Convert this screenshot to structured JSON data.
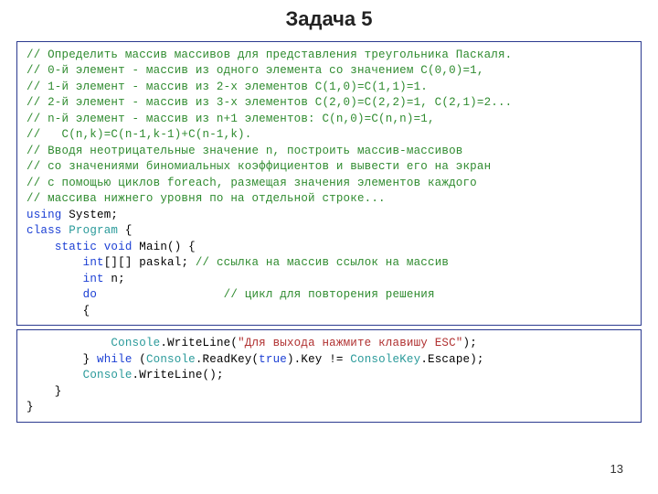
{
  "title": "Задача 5",
  "page_number": "13",
  "code1": {
    "c01": "// Определить массив массивов для представления треугольника Паскаля.",
    "c02": "// 0-й элемент - массив из одного элемента со значением С(0,0)=1,",
    "c03": "// 1-й элемент - массив из 2-х элементов С(1,0)=С(1,1)=1.",
    "c04": "// 2-й элемент - массив из 3-х элементов С(2,0)=С(2,2)=1, С(2,1)=2...",
    "c05": "// n-й элемент - массив из n+1 элементов: С(n,0)=С(n,n)=1,",
    "c06": "//   С(n,k)=C(n-1,k-1)+C(n-1,k).",
    "c07": "// Вводя неотрицательные значение n, построить массив-массивов",
    "c08": "// со значениями биномиальных коэффициентов и вывести его на экран",
    "c09": "// с помощью циклов foreach, размещая значения элементов каждого",
    "c10": "// массива нижнего уровня по на отдельной строке...",
    "k_using": "using",
    "t_system": " System;",
    "k_class": "class",
    "t_program": "Program",
    "t_openbrace": " {",
    "k_static": "static",
    "k_void": "void",
    "t_main": " Main() {",
    "k_int": "int",
    "t_paskal": "[][] paskal; ",
    "c_paskal": "// ссылка на массив ссылок на массив",
    "t_n": " n;",
    "k_do": "do",
    "c_do": "// цикл для повторения решения",
    "t_open": "        {"
  },
  "code2": {
    "t_console1": "Console",
    "t_wl1": ".WriteLine(",
    "s_msg": "\"Для выхода нажмите клавишу ESC\"",
    "t_close1": ");",
    "t_closebrace": "        } ",
    "k_while": "while",
    "t_paren": " (",
    "t_console2": "Console",
    "t_readkey": ".ReadKey(",
    "k_true": "true",
    "t_key": ").Key != ",
    "t_consolekey": "ConsoleKey",
    "t_escape": ".Escape);",
    "t_console3": "Console",
    "t_wl2": ".WriteLine();",
    "t_close2": "    }",
    "t_close3": "}"
  }
}
